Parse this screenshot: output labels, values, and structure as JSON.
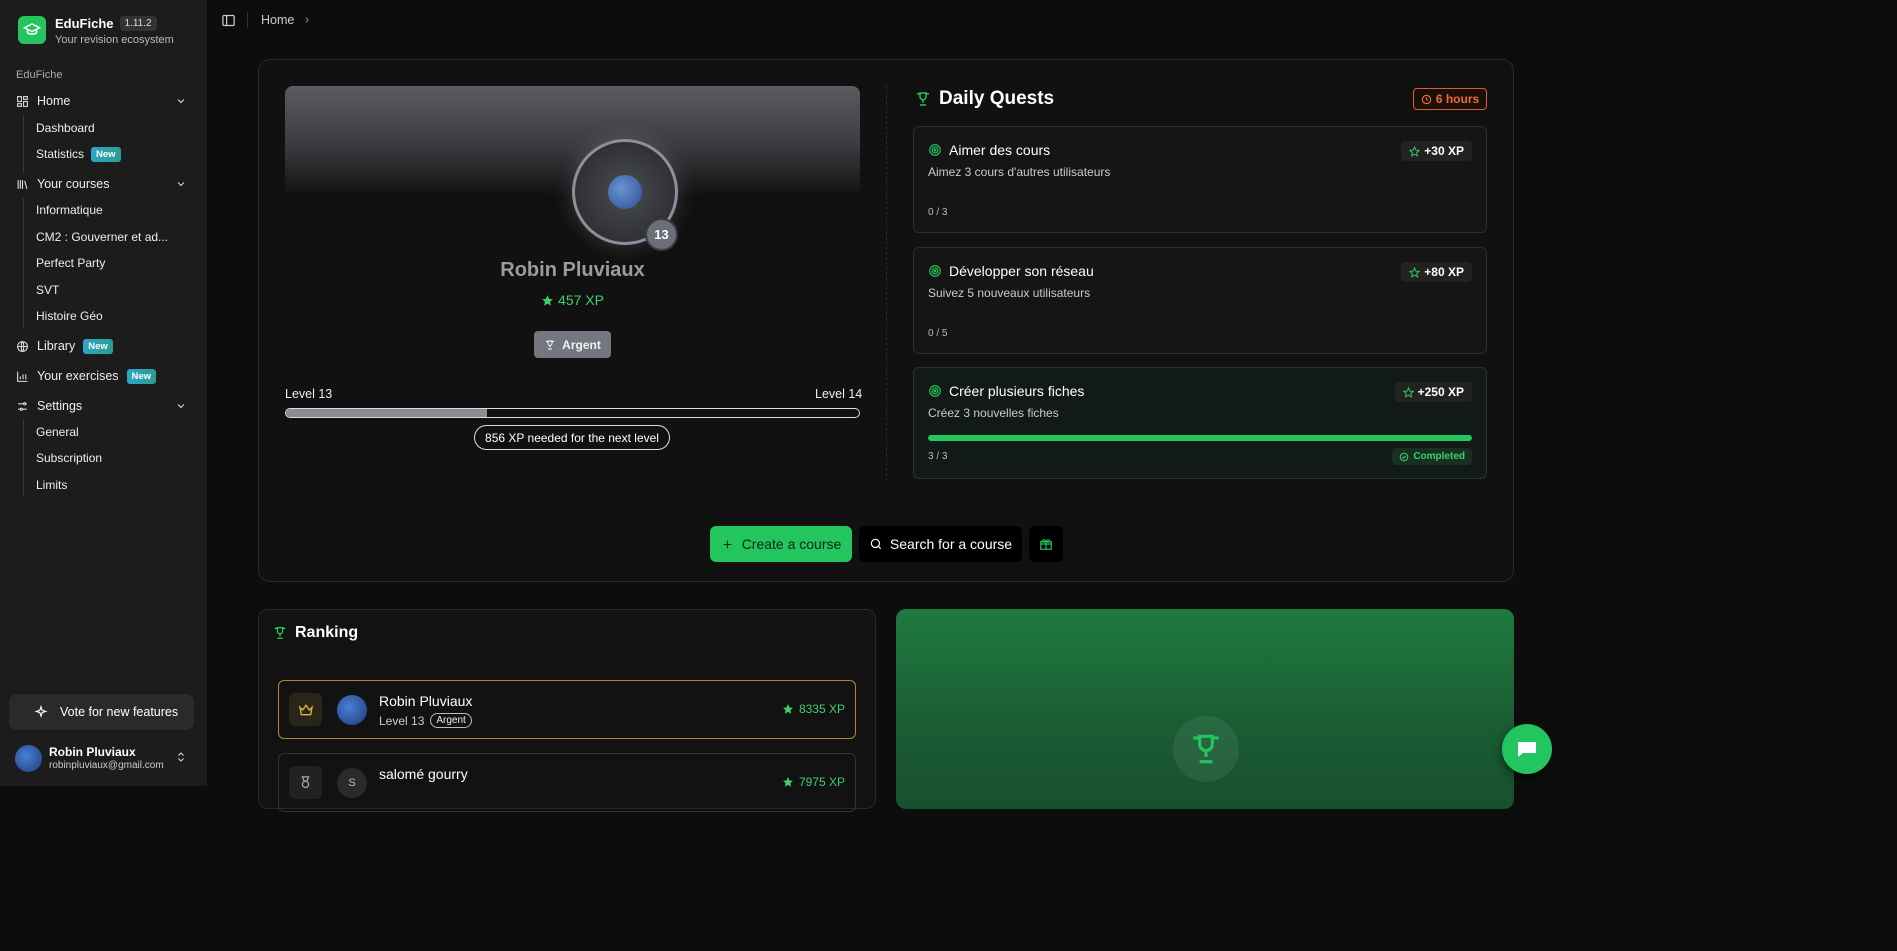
{
  "brand": {
    "name": "EduFiche",
    "version": "1.11.2",
    "tagline": "Your revision ecosystem"
  },
  "sidebar": {
    "group_label": "EduFiche",
    "home": {
      "label": "Home",
      "items": [
        {
          "label": "Dashboard"
        },
        {
          "label": "Statistics",
          "badge": "New"
        }
      ]
    },
    "courses": {
      "label": "Your courses",
      "items": [
        {
          "label": "Informatique"
        },
        {
          "label": "CM2 : Gouverner et ad..."
        },
        {
          "label": "Perfect Party"
        },
        {
          "label": "SVT"
        },
        {
          "label": "Histoire Géo"
        }
      ]
    },
    "library": {
      "label": "Library",
      "badge": "New"
    },
    "exercises": {
      "label": "Your exercises",
      "badge": "New"
    },
    "settings": {
      "label": "Settings",
      "items": [
        {
          "label": "General"
        },
        {
          "label": "Subscription"
        },
        {
          "label": "Limits"
        }
      ]
    },
    "vote_button": "Vote for new features",
    "user": {
      "name": "Robin Pluviaux",
      "email": "robinpluviaux@gmail.com"
    }
  },
  "breadcrumb": {
    "home": "Home"
  },
  "profile": {
    "name": "Robin Pluviaux",
    "xp": "457 XP",
    "level": "13",
    "rank": "Argent",
    "level_current": "Level 13",
    "level_next": "Level 14",
    "progress_fraction": 0.35,
    "xp_needed": "856 XP needed for the next level"
  },
  "daily_quests": {
    "title": "Daily Quests",
    "timer": "6 hours",
    "quests": [
      {
        "title": "Aimer des cours",
        "desc": "Aimez 3 cours d'autres utilisateurs",
        "progress": "0 / 3",
        "reward": "+30 XP"
      },
      {
        "title": "Développer son réseau",
        "desc": "Suivez 5 nouveaux utilisateurs",
        "progress": "0 / 5",
        "reward": "+80 XP"
      },
      {
        "title": "Créer plusieurs fiches",
        "desc": "Créez 3 nouvelles fiches",
        "progress": "3 / 3",
        "reward": "+250 XP",
        "status": "Completed"
      }
    ]
  },
  "actions": {
    "create": "Create a course",
    "search": "Search for a course"
  },
  "ranking": {
    "title": "Ranking",
    "rows": [
      {
        "name": "Robin Pluviaux",
        "level": "Level 13",
        "rank": "Argent",
        "xp": "8335 XP"
      },
      {
        "name": "salomé gourry",
        "initial": "S",
        "xp": "7975 XP"
      }
    ]
  },
  "colors": {
    "accent": "#22c55e",
    "timer": "#f06a35",
    "rank_gold": "#b08a2a"
  }
}
